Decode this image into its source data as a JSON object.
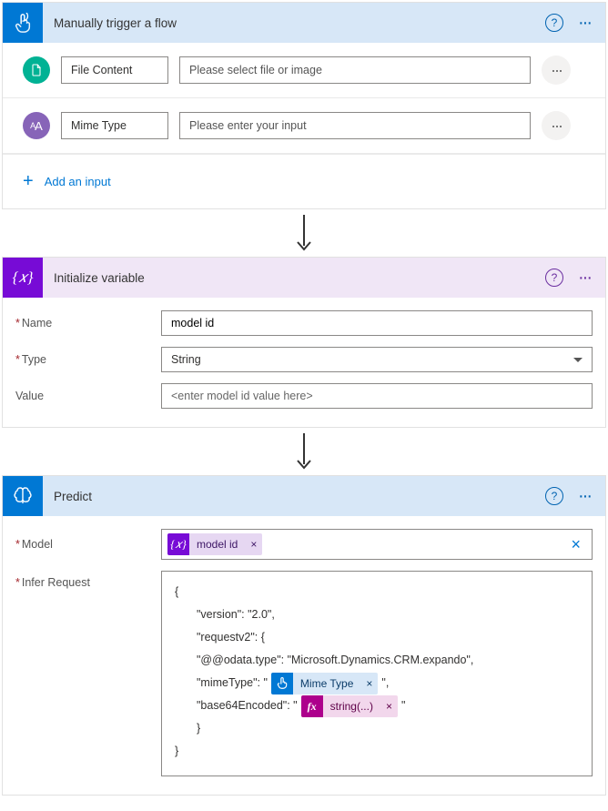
{
  "trigger": {
    "title": "Manually trigger a flow",
    "inputs": [
      {
        "label": "File Content",
        "placeholder": "Please select file or image",
        "icon_name": "file-icon",
        "icon_bg": "#00B294"
      },
      {
        "label": "Mime Type",
        "placeholder": "Please enter your input",
        "icon_name": "text-icon",
        "icon_bg": "#8764B8"
      }
    ],
    "add_input_label": "Add an input"
  },
  "initvar": {
    "title": "Initialize variable",
    "name_label": "Name",
    "name_value": "model id",
    "type_label": "Type",
    "type_value": "String",
    "value_label": "Value",
    "value_placeholder": "<enter model id value here>"
  },
  "predict": {
    "title": "Predict",
    "model_label": "Model",
    "model_token": "model id",
    "infer_label": "Infer Request",
    "json": {
      "open": "{",
      "version_key": "\"version\": \"2.0\",",
      "requestv2_key": "\"requestv2\": {",
      "odata_type": "\"@@odata.type\": \"Microsoft.Dynamics.CRM.expando\",",
      "mime_pre": "\"mimeType\": \"",
      "mime_token": "Mime Type",
      "mime_post": "\",",
      "b64_pre": "\"base64Encoded\": \"",
      "b64_token": "string(...)",
      "b64_post": "\"",
      "close_inner": "}",
      "close_outer": "}"
    }
  }
}
